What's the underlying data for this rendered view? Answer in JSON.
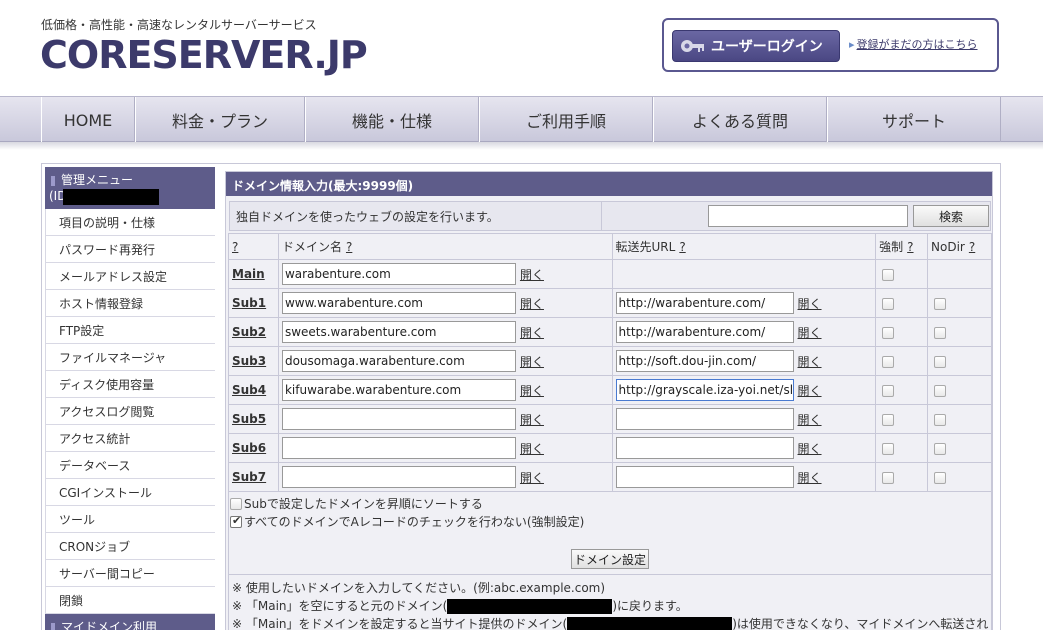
{
  "header": {
    "tagline": "低価格・高性能・高速なレンタルサーバーサービス",
    "logo": "CORESERVER.JP",
    "login_button": "ユーザーログイン",
    "register_link": "登録がまだの方はこちら"
  },
  "nav": [
    "HOME",
    "料金・プラン",
    "機能・仕様",
    "ご利用手順",
    "よくある質問",
    "サポート"
  ],
  "sidebar": {
    "title": "管理メニュー",
    "id_label": "(ID",
    "items": [
      "項目の説明・仕様",
      "パスワード再発行",
      "メールアドレス設定",
      "ホスト情報登録",
      "FTP設定",
      "ファイルマネージャ",
      "ディスク使用容量",
      "アクセスログ閲覧",
      "アクセス統計",
      "データベース",
      "CGIインストール",
      "ツール",
      "CRONジョブ",
      "サーバー間コピー",
      "閉鎖"
    ],
    "footer": "マイドメイン利用"
  },
  "panel": {
    "title": "ドメイン情報入力(最大:9999個)",
    "description": "独自ドメインを使ったウェブの設定を行います。",
    "search_button": "検索",
    "columns": {
      "help": "?",
      "domain": "ドメイン名",
      "url": "転送先URL",
      "force": "強制",
      "nodir": "NoDir"
    },
    "open_label": "開く",
    "rows": [
      {
        "label": "Main",
        "domain": "warabenture.com",
        "url": null
      },
      {
        "label": "Sub1",
        "domain": "www.warabenture.com",
        "url": "http://warabenture.com/"
      },
      {
        "label": "Sub2",
        "domain": "sweets.warabenture.com",
        "url": "http://warabenture.com/"
      },
      {
        "label": "Sub3",
        "domain": "dousomaga.warabenture.com",
        "url": "http://soft.dou-jin.com/"
      },
      {
        "label": "Sub4",
        "domain": "kifuwarabe.warabenture.com",
        "url": "http://grayscale.iza-yoi.net/sl"
      },
      {
        "label": "Sub5",
        "domain": "",
        "url": ""
      },
      {
        "label": "Sub6",
        "domain": "",
        "url": ""
      },
      {
        "label": "Sub7",
        "domain": "",
        "url": ""
      }
    ],
    "option_sort": "Subで設定したドメインを昇順にソートする",
    "option_sort_checked": false,
    "option_arecord": "すべてのドメインでAレコードのチェックを行わない(強制設定)",
    "option_arecord_checked": true,
    "submit_button": "ドメイン設定",
    "notes": {
      "n1": "※ 使用したいドメインを入力してください。(例:abc.example.com)",
      "n2_a": "※ 「Main」を空にすると元のドメイン(",
      "n2_b": ")に戻ります。",
      "n3_a": "※ 「Main」をドメインを設定すると当サイト提供のドメイン(",
      "n3_b": ")は使用できなくなり、マイドメインへ転送され"
    }
  }
}
